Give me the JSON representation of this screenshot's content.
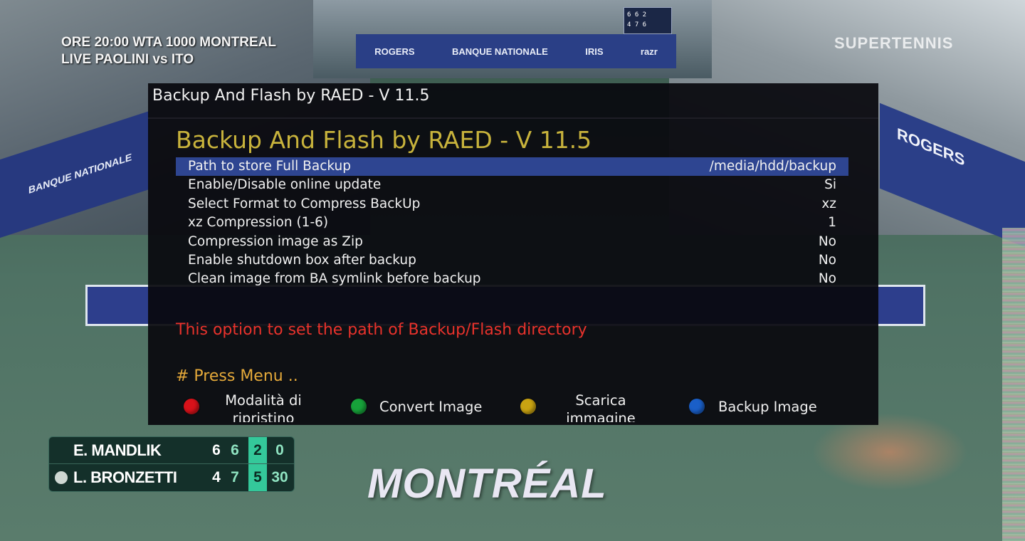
{
  "tv": {
    "overlay_line1": "ORE 20:00 WTA 1000 MONTREAL",
    "overlay_line2": "LIVE PAOLINI vs ITO",
    "channel_logo": "SUPERTENNIS",
    "city_name": "MONTRÉAL",
    "backwall_sponsors": [
      "ROGERS",
      "BANQUE NATIONALE",
      "IRIS",
      "razr"
    ],
    "side_sponsor_right": "ROGERS",
    "side_sponsor_left": "BANQUE NATIONALE",
    "scoreboard_mini_line1": "6 6 2",
    "scoreboard_mini_line2": "4 7 6"
  },
  "score": {
    "players": [
      {
        "name": "E. MANDLIK",
        "serving": false,
        "sets": [
          "6",
          "6"
        ],
        "current_set": "2",
        "points": "0"
      },
      {
        "name": "L. BRONZETTI",
        "serving": true,
        "sets": [
          "4",
          "7"
        ],
        "current_set": "5",
        "points": "30"
      }
    ]
  },
  "dialog": {
    "window_title": "Backup And Flash by RAED - V 11.5",
    "heading": "Backup And Flash by RAED - V 11.5",
    "settings": [
      {
        "label": "Path to store Full Backup",
        "value": "/media/hdd/backup",
        "selected": true
      },
      {
        "label": "Enable/Disable online update",
        "value": "Si",
        "selected": false
      },
      {
        "label": "Select Format to Compress BackUp",
        "value": "xz",
        "selected": false
      },
      {
        "label": "xz Compression (1-6)",
        "value": "1",
        "selected": false
      },
      {
        "label": "Compression image as Zip",
        "value": "No",
        "selected": false
      },
      {
        "label": "Enable shutdown box after backup",
        "value": "No",
        "selected": false
      },
      {
        "label": "Clean image from BA symlink before backup",
        "value": "No",
        "selected": false
      }
    ],
    "description": "This option to set the path of Backup/Flash directory",
    "hint": "# Press Menu ..",
    "buttons": [
      {
        "color_name": "red",
        "color": "#d9121a",
        "label": "Modalità di ripristino"
      },
      {
        "color_name": "green",
        "color": "#17a23a",
        "label": "Convert Image"
      },
      {
        "color_name": "yellow",
        "color": "#c9a312",
        "label": "Scarica immagine"
      },
      {
        "color_name": "blue",
        "color": "#1a5fc8",
        "label": "Backup Image"
      }
    ]
  }
}
